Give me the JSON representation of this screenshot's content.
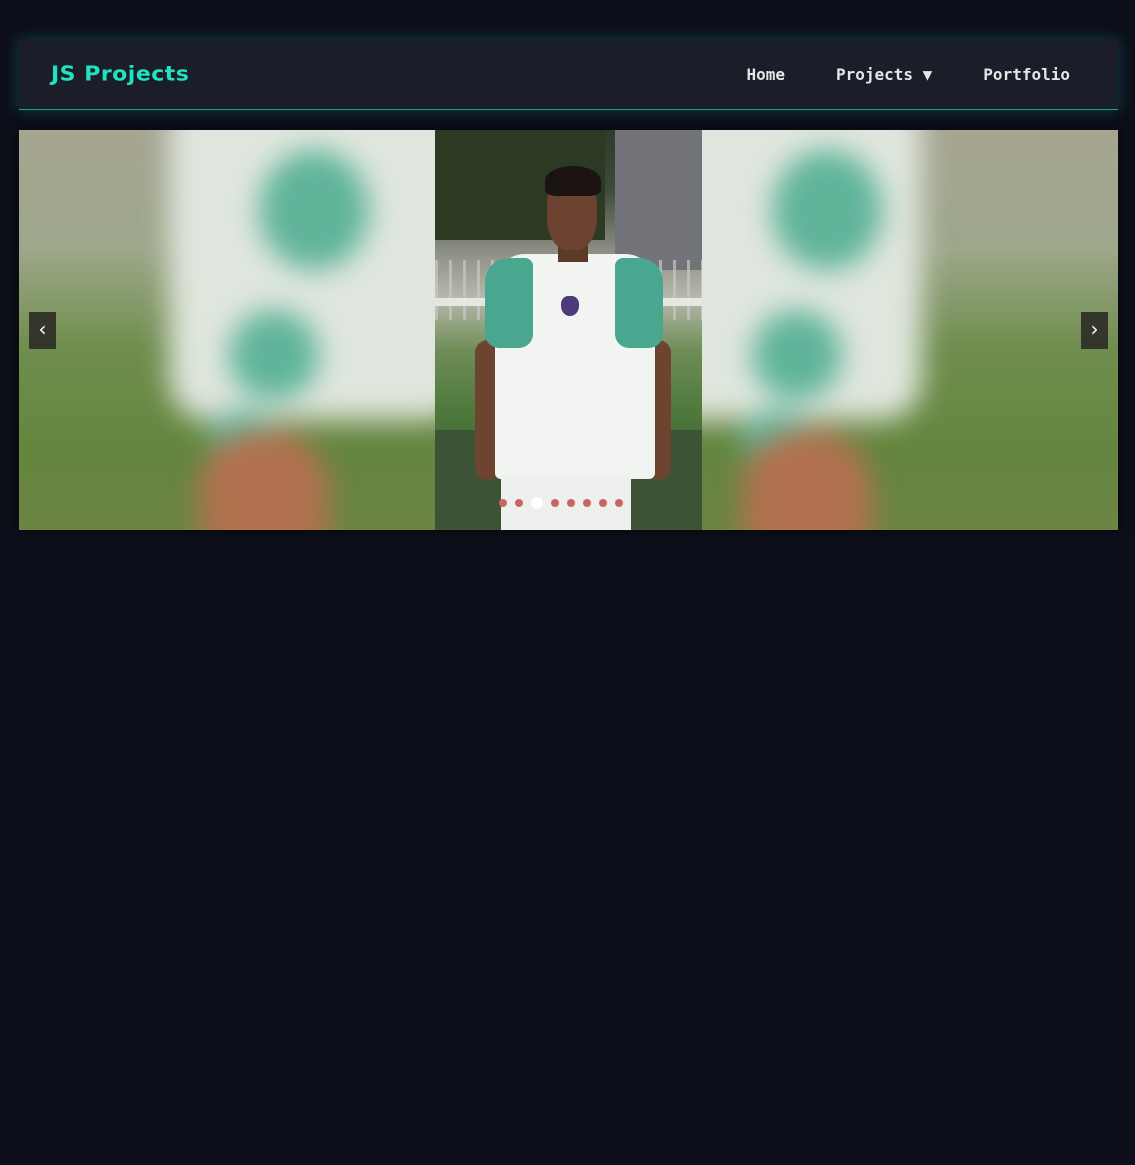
{
  "brand": {
    "title": "JS Projects"
  },
  "nav": {
    "home": "Home",
    "projects": "Projects ▼",
    "portfolio": "Portfolio"
  },
  "carousel": {
    "prev_label": "‹",
    "next_label": "›",
    "slide_count": 8,
    "active_index": 2
  },
  "colors": {
    "background": "#0d0f1a",
    "navbar": "#1b1d29",
    "accent": "#20e3c2",
    "dot": "#c8685d",
    "dot_active": "#ffffff"
  }
}
